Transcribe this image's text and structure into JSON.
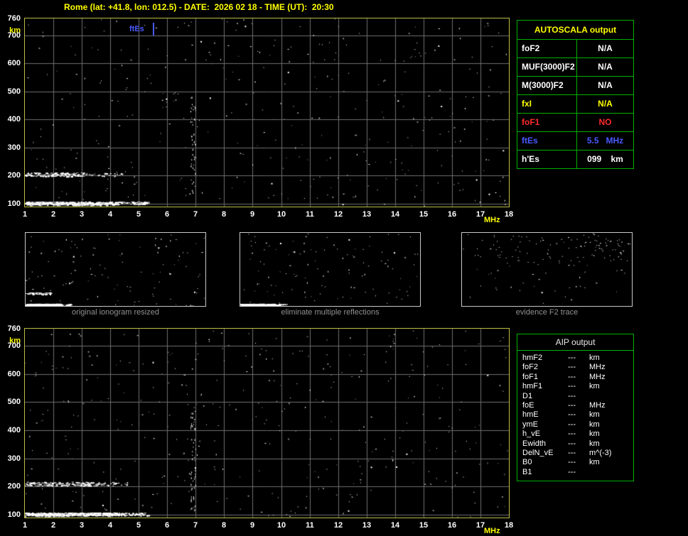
{
  "title": "Rome (lat: +41.8, lon: 012.5) - DATE:  2026 02 18 - TIME (UT):  20:30",
  "ionogram": {
    "y_unit": "km",
    "x_unit": "MHz",
    "y_ticks": [
      760,
      700,
      600,
      500,
      400,
      300,
      200,
      100
    ],
    "x_ticks": [
      "1",
      "2",
      "3",
      "4",
      "5",
      "6",
      "7",
      "8",
      "9",
      "10",
      "11",
      "12",
      "13",
      "14",
      "15",
      "16",
      "17",
      "18"
    ],
    "ftEs_label": "ftEs"
  },
  "autoscala_table": {
    "title": "AUTOSCALA output",
    "rows": [
      {
        "param": "foF2",
        "value": "N/A",
        "color": "white"
      },
      {
        "param": "MUF(3000)F2",
        "value": "N/A",
        "color": "white"
      },
      {
        "param": "M(3000)F2",
        "value": "N/A",
        "color": "white"
      },
      {
        "param": "fxI",
        "value": "N/A",
        "color": "yellow"
      },
      {
        "param": "foF1",
        "value": "NO",
        "color": "red"
      },
      {
        "param": "ftEs",
        "value": "5.5   MHz",
        "color": "blue"
      },
      {
        "param": "h'Es",
        "value": "099    km",
        "color": "white"
      }
    ]
  },
  "thumbnails": [
    {
      "caption": "original ionogram resized"
    },
    {
      "caption": "eliminate multiple reflections"
    },
    {
      "caption": "evidence F2 trace"
    }
  ],
  "aip_table": {
    "title": "AIP output",
    "rows": [
      {
        "param": "hmF2",
        "value": "---",
        "unit": "km"
      },
      {
        "param": "foF2",
        "value": "---",
        "unit": "MHz"
      },
      {
        "param": "foF1",
        "value": "---",
        "unit": "MHz"
      },
      {
        "param": "hmF1",
        "value": "---",
        "unit": "km"
      },
      {
        "param": "D1",
        "value": "---",
        "unit": ""
      },
      {
        "param": "foE",
        "value": "---",
        "unit": "MHz"
      },
      {
        "param": "hmE",
        "value": "---",
        "unit": "km"
      },
      {
        "param": "ymE",
        "value": "---",
        "unit": "km"
      },
      {
        "param": "h_vE",
        "value": "---",
        "unit": "km"
      },
      {
        "param": "Ewidth",
        "value": "---",
        "unit": "km"
      },
      {
        "param": "DelN_vE",
        "value": "---",
        "unit": "m^(-3)"
      },
      {
        "param": "B0",
        "value": "---",
        "unit": "km"
      },
      {
        "param": "B1",
        "value": "---",
        "unit": ""
      }
    ]
  },
  "chart_data": [
    {
      "type": "scatter",
      "title": "scaled ionogram (top)",
      "xlabel": "MHz",
      "ylabel": "km",
      "xlim": [
        1,
        18
      ],
      "ylim": [
        90,
        760
      ],
      "grid": true,
      "series": [
        {
          "name": "Es trace",
          "height_km": 100,
          "freq_range_mhz": [
            1.0,
            5.3
          ]
        },
        {
          "name": "Es second reflection",
          "height_km": 205,
          "freq_range_mhz": [
            1.0,
            4.4
          ]
        },
        {
          "name": "noise",
          "description": "random scattered echoes over whole plot"
        }
      ],
      "annotations": [
        {
          "label": "ftEs",
          "x_mhz": 5.5,
          "value": "5.5 MHz",
          "color": "blue"
        }
      ]
    },
    {
      "type": "scatter",
      "title": "restored ionogram (bottom)",
      "xlabel": "MHz",
      "ylabel": "km",
      "xlim": [
        1,
        18
      ],
      "ylim": [
        90,
        760
      ],
      "grid": true,
      "series": [
        {
          "name": "Es trace",
          "height_km": 100,
          "freq_range_mhz": [
            1.0,
            5.3
          ]
        },
        {
          "name": "Es second reflection",
          "height_km": 210,
          "freq_range_mhz": [
            1.0,
            4.6
          ]
        },
        {
          "name": "noise",
          "description": "random scattered echoes over whole plot"
        }
      ],
      "annotations": []
    }
  ],
  "colors": {
    "background": "#000000",
    "title": "#ffff00",
    "plot_border": "#bdbd44",
    "grid": "#6f6f6f",
    "axis_text": "#ffffff",
    "unit_text": "#ffff00",
    "table_border": "#00b000",
    "autoscala_title": "#ffff00",
    "value_blue": "#4a5aff",
    "value_red": "#ff2a2a",
    "thumb_caption": "#909090"
  }
}
